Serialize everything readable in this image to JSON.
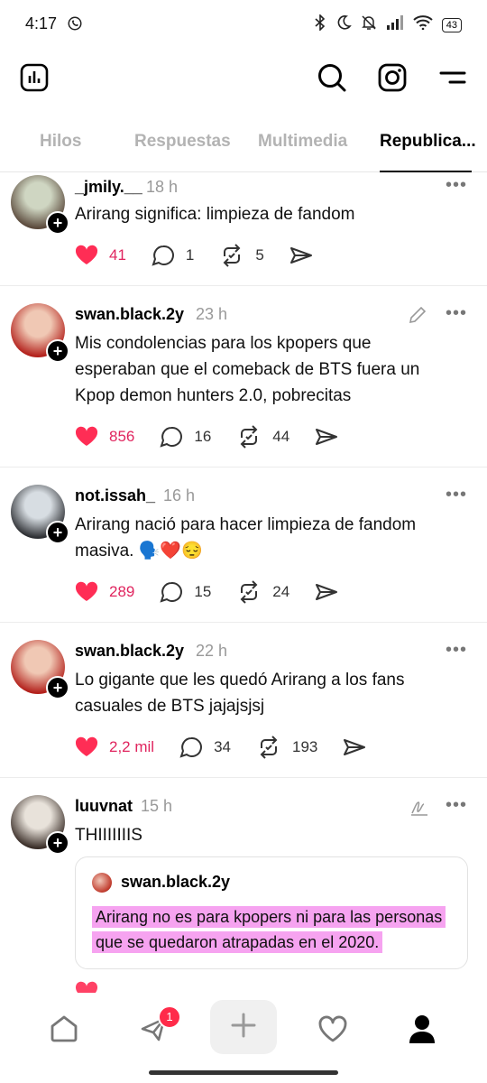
{
  "status": {
    "time": "4:17",
    "battery": "43"
  },
  "tabs": [
    {
      "label": "Hilos"
    },
    {
      "label": "Respuestas"
    },
    {
      "label": "Multimedia"
    },
    {
      "label": "Republica..."
    }
  ],
  "posts": [
    {
      "username": "_jmily.__",
      "time": "18 h",
      "text": "Arirang significa: limpieza de fandom",
      "likes": "41",
      "replies": "1",
      "reposts": "5",
      "avatar_colors": [
        "#cfd6c2",
        "#5b4a3c"
      ]
    },
    {
      "username": "swan.black.2y",
      "time": "23 h",
      "text": "Mis condolencias para los kpopers que esperaban que el comeback de BTS fuera un Kpop demon hunters 2.0, pobrecitas",
      "likes": "856",
      "replies": "16",
      "reposts": "44",
      "avatar_colors": [
        "#f0c8b4",
        "#b3211c"
      ]
    },
    {
      "username": "not.issah_",
      "time": "16 h",
      "text": "Arirang nació para hacer limpieza de fandom masiva. 🗣️❤️😔",
      "likes": "289",
      "replies": "15",
      "reposts": "24",
      "avatar_colors": [
        "#d7dde2",
        "#2d2f33"
      ]
    },
    {
      "username": "swan.black.2y",
      "time": "22 h",
      "text": "Lo gigante que les quedó Arirang a los fans casuales de BTS jajajsjsj",
      "likes": "2,2 mil",
      "replies": "34",
      "reposts": "193",
      "avatar_colors": [
        "#f0c8b4",
        "#b3211c"
      ]
    },
    {
      "username": "luuvnat",
      "time": "15 h",
      "text": "THIIIIIIIS",
      "avatar_colors": [
        "#e8e2da",
        "#3a2e28"
      ],
      "quote": {
        "username": "swan.black.2y",
        "text": "Arirang no es para kpopers ni para las personas que se quedaron atrapadas en el 2020."
      }
    }
  ],
  "nav": {
    "activity_badge": "1"
  },
  "icons": [
    "whatsapp-icon",
    "bluetooth-icon",
    "moon-icon",
    "bell-off-icon",
    "signal-icon",
    "wifi-icon",
    "insights-icon",
    "search-icon",
    "instagram-icon",
    "menu-icon",
    "heart-icon",
    "comment-icon",
    "repost-icon",
    "share-icon",
    "more-icon",
    "edit-icon",
    "home-icon",
    "activity-icon",
    "plus-icon",
    "profile-icon"
  ]
}
